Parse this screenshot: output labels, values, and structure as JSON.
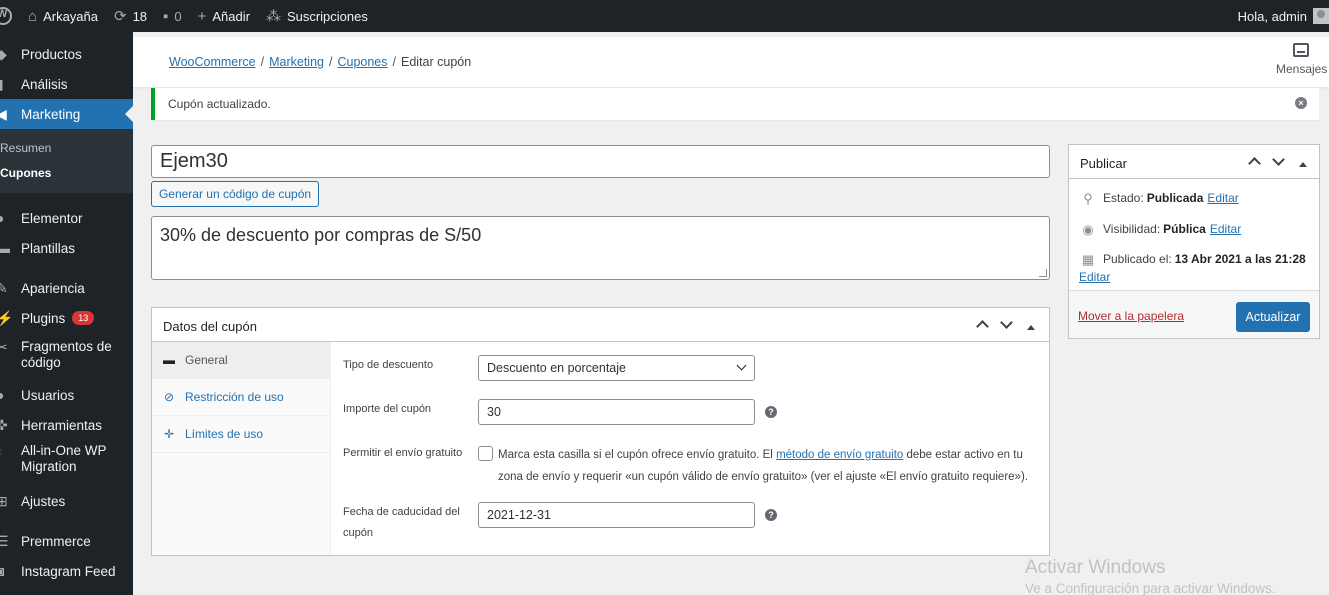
{
  "admin_bar": {
    "site_name": "Arkayaña",
    "updates_count": "18",
    "comments_count": "0",
    "new_label": "Añadir",
    "subscriptions_label": "Suscripciones",
    "greeting": "Hola, admin"
  },
  "sidebar": {
    "items_top": [
      {
        "label": "Productos",
        "icon": "box-icon"
      },
      {
        "label": "Análisis",
        "icon": "bar-chart-icon"
      },
      {
        "label": "Marketing",
        "icon": "megaphone-icon"
      }
    ],
    "submenu": [
      "Resumen",
      "Cupones"
    ],
    "items_bottom": [
      {
        "label": "Elementor",
        "icon": "elementor-icon"
      },
      {
        "label": "Plantillas",
        "icon": "folder-icon"
      },
      {
        "label": "Apariencia",
        "icon": "brush-icon"
      },
      {
        "label": "Plugins",
        "icon": "plug-icon",
        "badge": "13"
      },
      {
        "label": "Fragmentos de código",
        "icon": "scissors-icon"
      },
      {
        "label": "Usuarios",
        "icon": "user-icon"
      },
      {
        "label": "Herramientas",
        "icon": "wrench-icon"
      },
      {
        "label": "All-in-One WP Migration",
        "icon": "migration-icon"
      },
      {
        "label": "Ajustes",
        "icon": "sliders-icon"
      },
      {
        "label": "Premmerce",
        "icon": "list-icon"
      },
      {
        "label": "Instagram Feed",
        "icon": "camera-icon"
      }
    ]
  },
  "header": {
    "breadcrumbs": [
      "WooCommerce",
      "Marketing",
      "Cupones"
    ],
    "current": "Editar cupón",
    "messages_label": "Mensajes"
  },
  "notice": {
    "text": "Cupón actualizado."
  },
  "coupon": {
    "code": "Ejem30",
    "generate_label": "Generar un código de cupón",
    "description": "30% de descuento por compras de S/50"
  },
  "coupon_data": {
    "title": "Datos del cupón",
    "tabs": [
      "General",
      "Restricción de uso",
      "Límites de uso"
    ],
    "fields": {
      "discount_type_label": "Tipo de descuento",
      "discount_type_value": "Descuento en porcentaje",
      "amount_label": "Importe del cupón",
      "amount_value": "30",
      "free_shipping_label": "Permitir el envío gratuito",
      "free_shipping_text_1": "Marca esta casilla si el cupón ofrece envío gratuito. El ",
      "free_shipping_link": "método de envío gratuito",
      "free_shipping_text_2": " debe estar activo en tu zona de envío y requerir «un cupón válido de envío gratuito» (ver el ajuste «El envío gratuito requiere»).",
      "free_shipping_checked": false,
      "expiry_label": "Fecha de caducidad del cupón",
      "expiry_value": "2021-12-31"
    }
  },
  "publish": {
    "title": "Publicar",
    "status_label": "Estado:",
    "status_value": "Publicada",
    "visibility_label": "Visibilidad:",
    "visibility_value": "Pública",
    "edit_label": "Editar",
    "published_label": "Publicado el:",
    "published_value": "13 Abr 2021 a las 21:28",
    "trash_label": "Mover a la papelera",
    "update_label": "Actualizar"
  },
  "watermark": {
    "line1": "Activar Windows",
    "line2": "Ve a Configuración para activar Windows."
  },
  "colors": {
    "accent": "#2271b1",
    "sidebar_bg": "#1d2327",
    "success": "#00a32a",
    "badge": "#d63638"
  }
}
